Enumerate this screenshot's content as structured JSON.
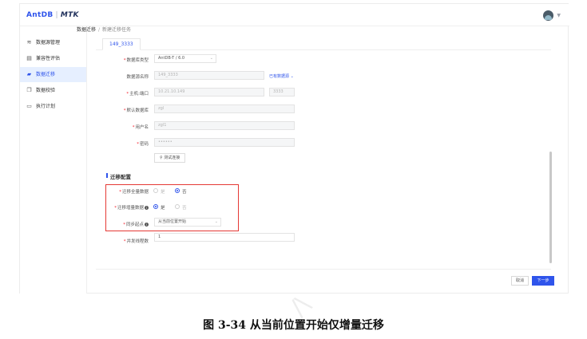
{
  "header": {
    "logo_brand": "AntDB",
    "logo_sep": "|",
    "logo_product": "MTK"
  },
  "sidebar": {
    "items": [
      {
        "label": "数据源管理",
        "icon": "database-stack-icon"
      },
      {
        "label": "兼容性评估",
        "icon": "document-icon"
      },
      {
        "label": "数据迁移",
        "icon": "folder-icon"
      },
      {
        "label": "数据校验",
        "icon": "copy-icon"
      },
      {
        "label": "执行计划",
        "icon": "calendar-icon"
      }
    ],
    "active_index": 2
  },
  "breadcrumb": {
    "root": "数据迁移",
    "separator": "/",
    "current": "新建迁移任务"
  },
  "tab": {
    "label": "149_3333"
  },
  "form": {
    "db_type": {
      "label": "数据库类型",
      "value": "AntDB-T / 6.0"
    },
    "source_name": {
      "label": "数据源名称",
      "value": "149_3333",
      "link": "已有数据源"
    },
    "host_port": {
      "label": "主机:端口",
      "host": "10.21.10.149",
      "port": "3333"
    },
    "default_db": {
      "label": "默认数据库",
      "value": "zgl"
    },
    "username": {
      "label": "用户名",
      "value": "zgl1"
    },
    "password": {
      "label": "密码",
      "value": "••••••"
    },
    "test_button": "测试连接"
  },
  "migration": {
    "title": "迁移配置",
    "full_data": {
      "label": "迁移全量数据",
      "options": [
        "是",
        "否"
      ],
      "selected": "否"
    },
    "incremental": {
      "label": "迁移增量数据",
      "options": [
        "是",
        "否"
      ],
      "selected": "是"
    },
    "sync_start": {
      "label": "同步起点",
      "value": "从当前位置开始"
    },
    "concurrency": {
      "label": "并发线程数",
      "value": "1"
    }
  },
  "footer": {
    "cancel": "取消",
    "next": "下一步"
  },
  "caption": "图 3-34  从当前位置开始仅增量迁移",
  "colors": {
    "accent": "#2f54eb",
    "highlight_box": "#e53935",
    "required": "#f5222d"
  }
}
